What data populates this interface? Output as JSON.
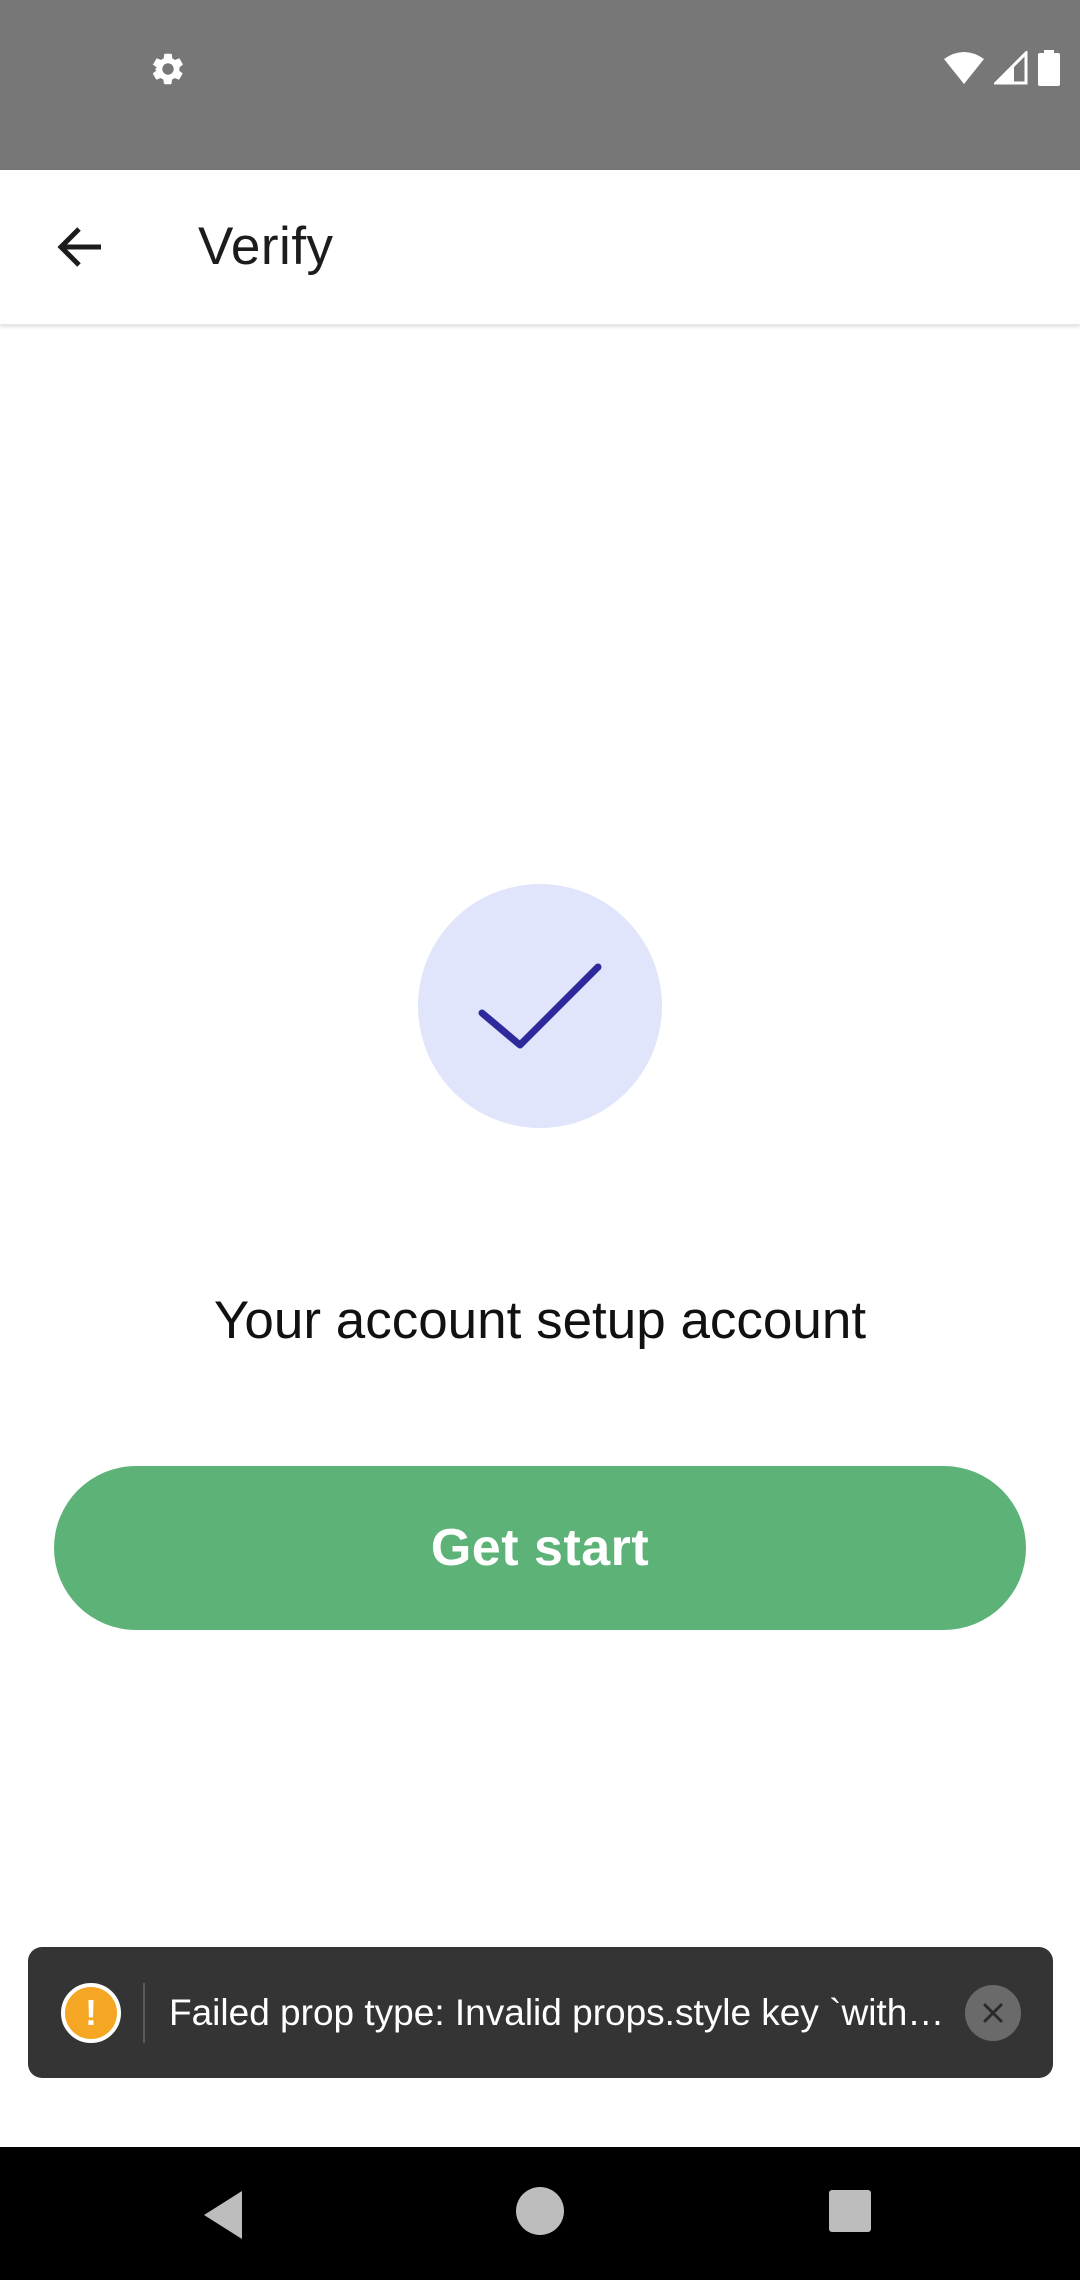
{
  "status_bar": {
    "settings_icon": "gear-icon",
    "wifi_icon": "wifi-icon",
    "signal_icon": "cell-signal-icon",
    "battery_icon": "battery-icon"
  },
  "app_bar": {
    "back_icon": "arrow-left-icon",
    "title": "Verify"
  },
  "main": {
    "status_icon": "check-icon",
    "message": "Your account setup account",
    "button_label": "Get start"
  },
  "toast": {
    "icon": "warning-icon",
    "icon_glyph": "!",
    "text": "Failed prop type: Invalid props.style key `with…",
    "close_icon": "close-icon"
  },
  "nav_bar": {
    "back_icon": "nav-back-icon",
    "home_icon": "nav-home-icon",
    "recents_icon": "nav-recents-icon"
  },
  "colors": {
    "status_bar": "#777777",
    "accent_green": "#5db277",
    "check_bg": "#e0e5fb",
    "check_stroke": "#2f2a9b",
    "toast_bg": "#343434",
    "warning": "#f5a623"
  }
}
